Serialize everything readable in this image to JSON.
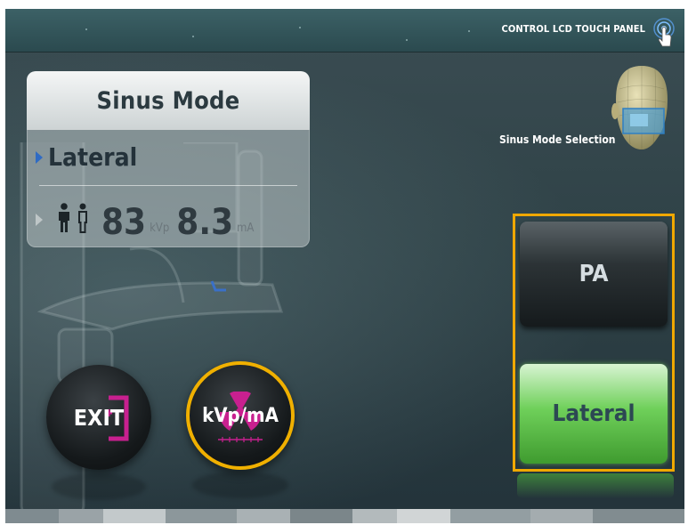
{
  "header": {
    "panel_title": "CONTROL LCD TOUCH PANEL",
    "touch_icon": "touch-hand-icon"
  },
  "card": {
    "title": "Sinus Mode",
    "mode_label": "Lateral",
    "kvp_value": "83",
    "kvp_unit": "kVp",
    "ma_value": "8.3",
    "ma_unit": "mA"
  },
  "selection": {
    "label": "Sinus Mode Selection",
    "options": [
      "PA",
      "Lateral"
    ],
    "selected": "Lateral"
  },
  "buttons": {
    "exit": "EXIT",
    "kvp_ma": "kVp/mA"
  },
  "colors": {
    "accent_orange": "#f0a800",
    "selected_green": "#6fd05a",
    "radiation_magenta": "#c8208f",
    "arrow_blue": "#2f6bc4"
  }
}
